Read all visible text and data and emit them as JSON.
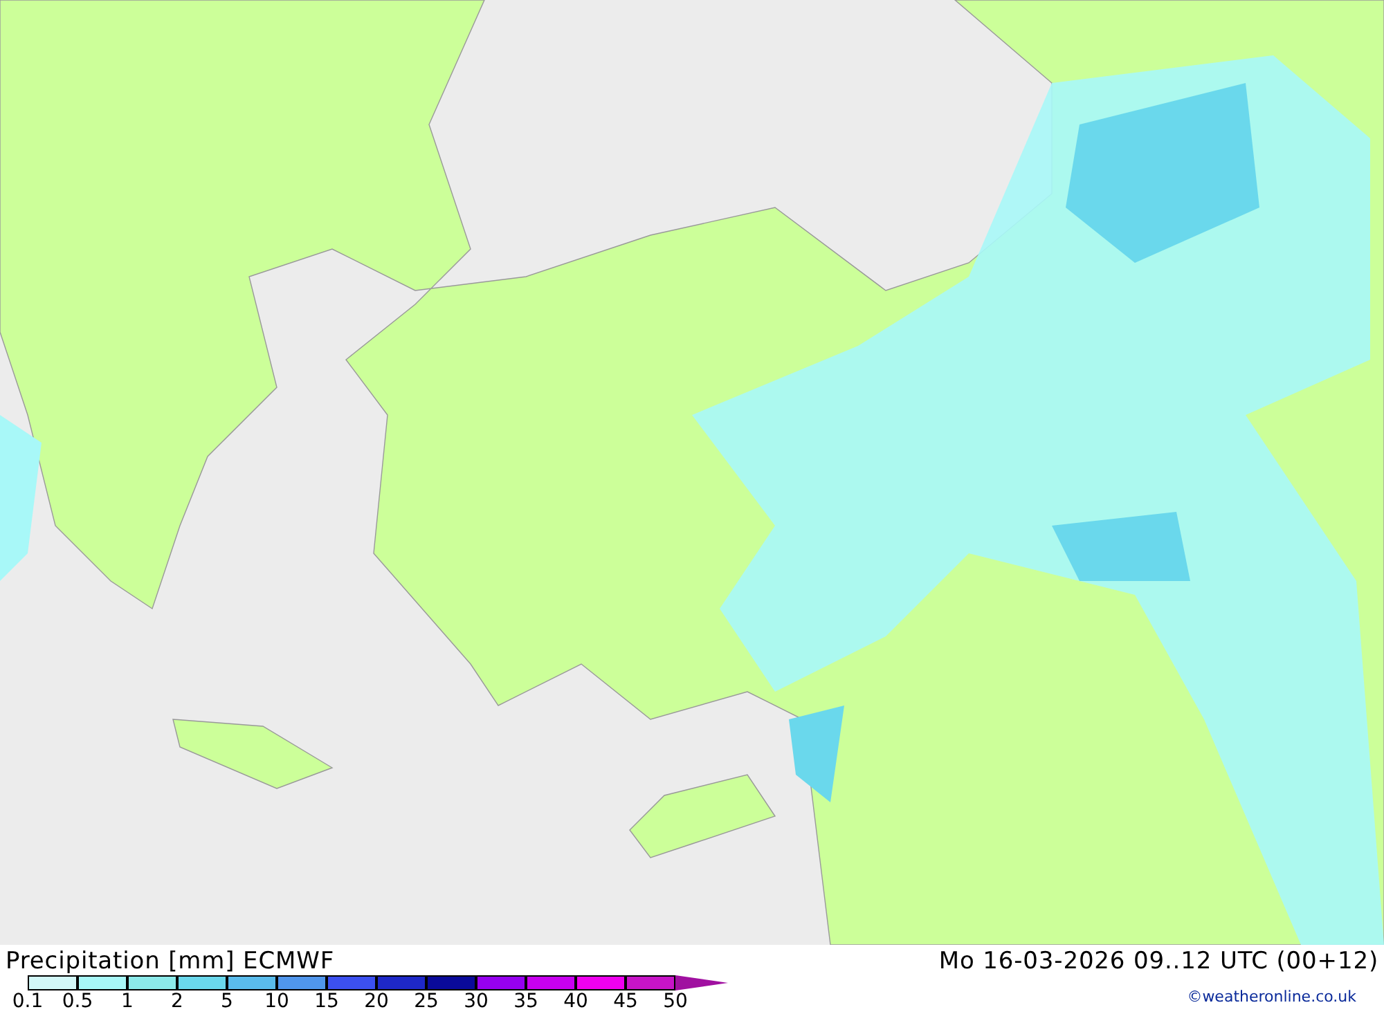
{
  "title": "Precipitation [mm] ECMWF",
  "valid_time": "Mo 16-03-2026 09..12 UTC (00+12)",
  "legend": {
    "labels": [
      "0.1",
      "0.5",
      "1",
      "2",
      "5",
      "10",
      "15",
      "20",
      "25",
      "30",
      "35",
      "40",
      "45",
      "50"
    ],
    "bins": [
      {
        "color": "#d2f8f8"
      },
      {
        "color": "#a8f8f8"
      },
      {
        "color": "#8ceaea"
      },
      {
        "color": "#6ad8ec"
      },
      {
        "color": "#5abcec"
      },
      {
        "color": "#5096ec"
      },
      {
        "color": "#3c50f0"
      },
      {
        "color": "#1e28c8"
      },
      {
        "color": "#0a0a9a"
      },
      {
        "color": "#9600f0"
      },
      {
        "color": "#c800f0"
      },
      {
        "color": "#f000f0"
      },
      {
        "color": "#c814c8"
      }
    ],
    "overflow": {
      "color": "#a010a0"
    }
  },
  "credit": "©weatheronline.co.uk"
}
